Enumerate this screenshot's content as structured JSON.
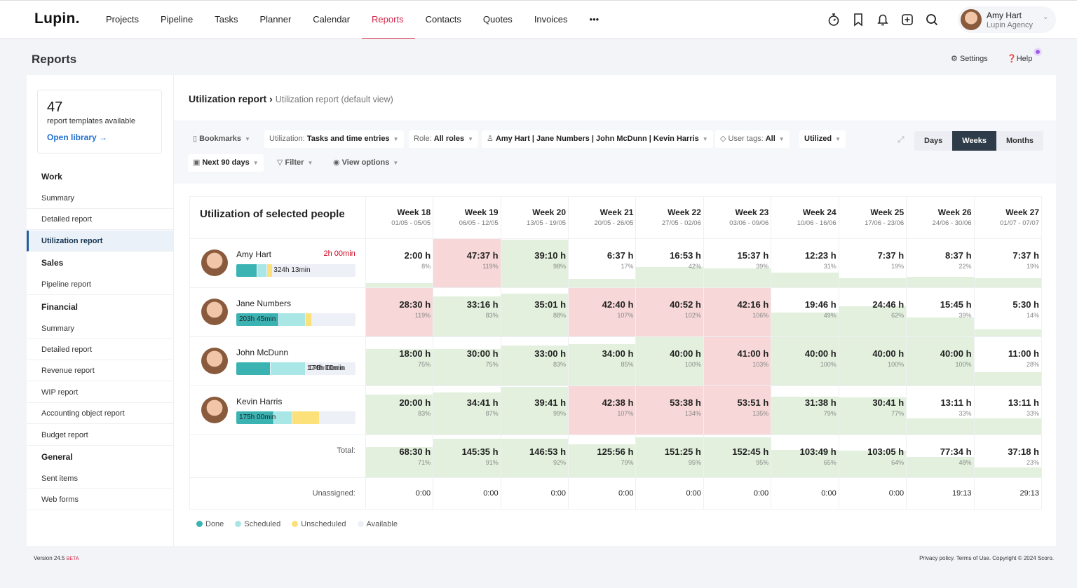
{
  "app": {
    "logo": "Lupin.",
    "nav": [
      "Projects",
      "Pipeline",
      "Tasks",
      "Planner",
      "Calendar",
      "Reports",
      "Contacts",
      "Quotes",
      "Invoices",
      "•••"
    ],
    "active_nav": "Reports",
    "user": {
      "name": "Amy Hart",
      "company": "Lupin Agency"
    }
  },
  "page": {
    "title": "Reports",
    "settings": "Settings",
    "help": "Help"
  },
  "sidebar": {
    "library": {
      "count": "47",
      "text": "report templates available",
      "link": "Open library →"
    },
    "sections": [
      {
        "title": "Work",
        "items": [
          "Summary",
          "Detailed report",
          "Utilization report"
        ]
      },
      {
        "title": "Sales",
        "items": [
          "Pipeline report"
        ]
      },
      {
        "title": "Financial",
        "items": [
          "Summary",
          "Detailed report",
          "Revenue report",
          "WIP report",
          "Accounting object report",
          "Budget report"
        ]
      },
      {
        "title": "General",
        "items": [
          "Sent items",
          "Web forms"
        ]
      }
    ],
    "active_item": "Utilization report"
  },
  "breadcrumb": {
    "title": "Utilization report",
    "sep": "›",
    "view": "Utilization report (default view)"
  },
  "filters": {
    "bookmarks": "Bookmarks",
    "utilization_label": "Utilization:",
    "utilization_value": "Tasks and time entries",
    "role_label": "Role:",
    "role_value": "All roles",
    "people": "Amy Hart | Jane Numbers | John McDunn | Kevin Harris",
    "tags_label": "User tags:",
    "tags_value": "All",
    "utilized": "Utilized",
    "period": "Next 90 days",
    "filter": "Filter",
    "view_options": "View options",
    "scale": [
      "Days",
      "Weeks",
      "Months"
    ],
    "active_scale": "Weeks"
  },
  "table": {
    "title": "Utilization of selected people",
    "weeks": [
      {
        "name": "Week 18",
        "range": "01/05 - 05/05"
      },
      {
        "name": "Week 19",
        "range": "06/05 - 12/05"
      },
      {
        "name": "Week 20",
        "range": "13/05 - 19/05"
      },
      {
        "name": "Week 21",
        "range": "20/05 - 26/05"
      },
      {
        "name": "Week 22",
        "range": "27/05 - 02/06"
      },
      {
        "name": "Week 23",
        "range": "03/06 - 09/06"
      },
      {
        "name": "Week 24",
        "range": "10/06 - 16/06"
      },
      {
        "name": "Week 25",
        "range": "17/06 - 23/06"
      },
      {
        "name": "Week 26",
        "range": "24/06 - 30/06"
      },
      {
        "name": "Week 27",
        "range": "01/07 - 07/07"
      }
    ],
    "people": [
      {
        "name": "Amy Hart",
        "overtime": "2h 00min",
        "bar_label": "324h 13min",
        "bar": {
          "done": 17,
          "scheduled": 8,
          "unscheduled": 4
        },
        "hours": [
          "2:00 h",
          "47:37 h",
          "39:10 h",
          "6:37 h",
          "16:53 h",
          "15:37 h",
          "12:23 h",
          "7:37 h",
          "8:37 h",
          "7:37 h"
        ],
        "pct": [
          8,
          119,
          98,
          17,
          42,
          39,
          31,
          19,
          22,
          19
        ]
      },
      {
        "name": "Jane Numbers",
        "overtime": "",
        "bar_label": "203h 45min",
        "bar": {
          "done": 35,
          "scheduled": 22,
          "unscheduled": 5
        },
        "hours": [
          "28:30 h",
          "33:16 h",
          "35:01 h",
          "42:40 h",
          "40:52 h",
          "42:16 h",
          "19:46 h",
          "24:46 h",
          "15:45 h",
          "5:30 h"
        ],
        "pct": [
          119,
          83,
          88,
          107,
          102,
          106,
          49,
          62,
          39,
          14
        ]
      },
      {
        "name": "John McDunn",
        "overtime": "",
        "bar_label": "174h 00min",
        "available_label": "176h 00min",
        "bar": {
          "done": 28,
          "scheduled": 29,
          "unscheduled": 0
        },
        "hours": [
          "18:00 h",
          "30:00 h",
          "33:00 h",
          "34:00 h",
          "40:00 h",
          "41:00 h",
          "40:00 h",
          "40:00 h",
          "40:00 h",
          "11:00 h"
        ],
        "pct": [
          75,
          75,
          83,
          85,
          100,
          103,
          100,
          100,
          100,
          28
        ]
      },
      {
        "name": "Kevin Harris",
        "overtime": "",
        "bar_label": "175h 00min",
        "bar": {
          "done": 31,
          "scheduled": 15,
          "unscheduled": 22
        },
        "hours": [
          "20:00 h",
          "34:41 h",
          "39:41 h",
          "42:38 h",
          "53:38 h",
          "53:51 h",
          "31:38 h",
          "30:41 h",
          "13:11 h",
          "13:11 h"
        ],
        "pct": [
          83,
          87,
          99,
          107,
          134,
          135,
          79,
          77,
          33,
          33
        ]
      }
    ],
    "total": {
      "label": "Total:",
      "hours": [
        "68:30 h",
        "145:35 h",
        "146:53 h",
        "125:56 h",
        "151:25 h",
        "152:45 h",
        "103:49 h",
        "103:05 h",
        "77:34 h",
        "37:18 h"
      ],
      "pct": [
        71,
        91,
        92,
        79,
        95,
        95,
        65,
        64,
        48,
        23
      ]
    },
    "unassigned": {
      "label": "Unassigned:",
      "values": [
        "0:00",
        "0:00",
        "0:00",
        "0:00",
        "0:00",
        "0:00",
        "0:00",
        "0:00",
        "19:13",
        "29:13"
      ]
    }
  },
  "legend": [
    {
      "label": "Done",
      "color": "#3bb3b3"
    },
    {
      "label": "Scheduled",
      "color": "#a9e6e6"
    },
    {
      "label": "Unscheduled",
      "color": "#fce17a"
    },
    {
      "label": "Available",
      "color": "#eef0f7"
    }
  ],
  "colors": {
    "under": "#e2f0dd",
    "over": "#f7d7d7",
    "accent": "#d6274a"
  },
  "footer": {
    "version": "Version 24.5",
    "beta": "BETA",
    "right": "Privacy policy. Terms of Use. Copyright © 2024 Scoro."
  }
}
